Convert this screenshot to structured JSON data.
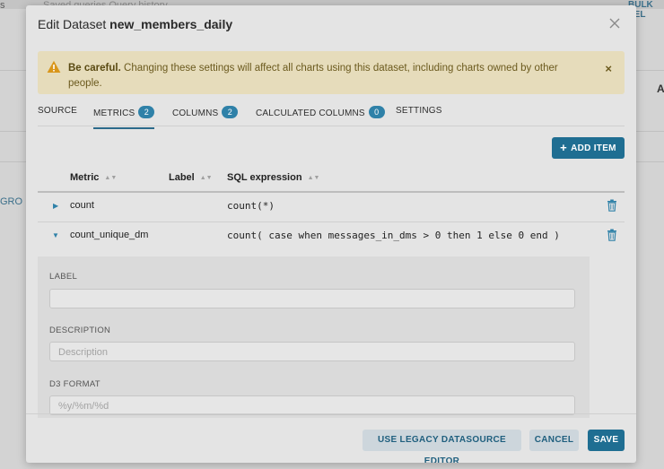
{
  "background": {
    "frag_top_left": "s",
    "frag_top_mid": "Saved queries    Query history",
    "frag_top_right": "BULK SEL",
    "frag_right": "A",
    "frag_left": "GRO"
  },
  "modal": {
    "title_prefix": "Edit Dataset ",
    "title_name": "new_members_daily"
  },
  "alert": {
    "bold": "Be careful.",
    "text": " Changing these settings will affect all charts using this dataset, including charts owned by other people.",
    "close": "×"
  },
  "tabs": [
    {
      "label": "SOURCE"
    },
    {
      "label": "METRICS",
      "badge": "2"
    },
    {
      "label": "COLUMNS",
      "badge": "2"
    },
    {
      "label": "CALCULATED COLUMNS",
      "badge": "0"
    },
    {
      "label": "SETTINGS"
    }
  ],
  "add_item": {
    "label": "ADD ITEM",
    "icon": "plus-icon"
  },
  "table": {
    "headers": [
      "Metric",
      "Label",
      "SQL expression"
    ],
    "rows": [
      {
        "metric": "count",
        "label": "",
        "sql": "count(*)"
      },
      {
        "metric": "count_unique_dm",
        "label": "",
        "sql": "count( case when messages_in_dms > 0 then 1 else 0 end )"
      }
    ]
  },
  "detail": {
    "label_title": "LABEL",
    "label_value": "",
    "description_title": "DESCRIPTION",
    "description_placeholder": "Description",
    "d3_title": "D3 FORMAT",
    "d3_placeholder": "%y/%m/%d"
  },
  "footer": {
    "legacy": "USE LEGACY DATASOURCE EDITOR",
    "cancel": "CANCEL",
    "save": "SAVE"
  },
  "colors": {
    "accent": "#1f6e92",
    "badge": "#2f81a8",
    "warning_bg": "#e6dcbb"
  }
}
